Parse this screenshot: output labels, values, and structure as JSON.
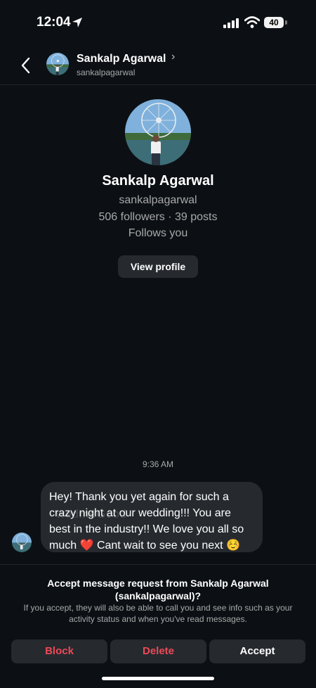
{
  "status_bar": {
    "time": "12:04",
    "battery": "40"
  },
  "header": {
    "name": "Sankalp Agarwal",
    "chevron": "›",
    "username": "sankalpagarwal"
  },
  "profile": {
    "name": "Sankalp Agarwal",
    "username": "sankalpagarwal",
    "stats": "506 followers · 39 posts",
    "follows_you": "Follows you",
    "view_profile_label": "View profile"
  },
  "conversation": {
    "timestamp": "9:36 AM",
    "message": "Hey! Thank you yet again for such a crazy night at our wedding!!! You are best in the industry!! We love you all so much ❤️ Cant wait to see you next ☺️"
  },
  "watermark": {
    "part1": "wed",
    "part2": "me",
    "part3": "Good"
  },
  "request": {
    "title": "Accept message request from Sankalp Agarwal (sankalpagarwal)?",
    "description": "If you accept, they will also be able to call you and see info such as your activity status and when you've read messages."
  },
  "actions": {
    "block": "Block",
    "delete": "Delete",
    "accept": "Accept"
  },
  "colors": {
    "background": "#0c1014",
    "danger": "#ed4956",
    "button_bg": "#262a2f",
    "secondary_text": "#a8a8a8"
  },
  "icons": [
    "location-arrow-icon",
    "signal-icon",
    "wifi-icon",
    "battery-icon",
    "back-arrow-icon",
    "chevron-right-icon"
  ]
}
